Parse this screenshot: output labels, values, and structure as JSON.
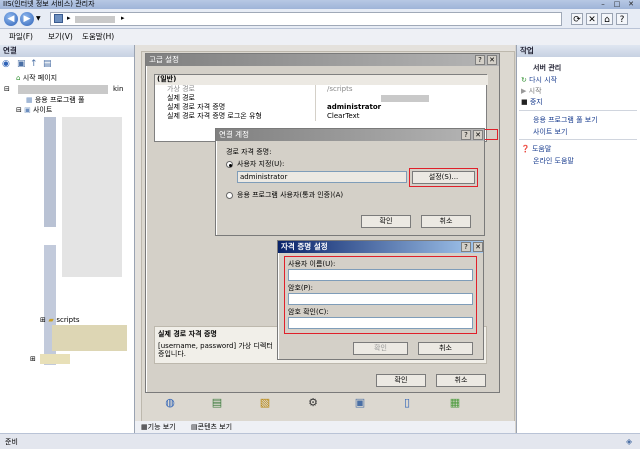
{
  "window": {
    "title": "IIS(인터넷 정보 서비스) 관리자"
  },
  "address": {
    "sep1": "▸",
    "sep2": "▸"
  },
  "menubar": {
    "items": [
      "파일(F)",
      "보기(V)",
      "도움말(H)"
    ]
  },
  "connections": {
    "header": "연결",
    "start_page": "시작 페이지",
    "server_suffix": "kin",
    "app_pools": "응용 프로그램 풀",
    "sites": "사이트",
    "scripts": "scripts"
  },
  "advanced_settings": {
    "title": "고급 설정",
    "section": "(일반)",
    "rows": [
      {
        "name": "가상 경로",
        "value": "/scripts"
      },
      {
        "name": "실제 경로",
        "value": ""
      },
      {
        "name": "실제 경로 자격 증명",
        "value": "administrator"
      },
      {
        "name": "실제 경로 자격 증명 로그온 유형",
        "value": "ClearText"
      }
    ],
    "desc_title": "실제 경로 자격 증명",
    "desc_line1": "[username, password] 가상 디렉터",
    "desc_line2": "증입니다.",
    "ok": "확인",
    "cancel": "취소"
  },
  "connect_as": {
    "title": "연결 계정",
    "path_credentials": "경로 자격 증명:",
    "specific_user": "사용자 지정(U):",
    "user_value": "administrator",
    "set_button": "설정(S)...",
    "app_user": "응용 프로그램 사용자(통과 인증)(A)",
    "ok": "확인",
    "cancel": "취소"
  },
  "set_credentials": {
    "title": "자격 증명 설정",
    "username_label": "사용자 이름(U):",
    "password_label": "암호(P):",
    "confirm_label": "암호 확인(C):",
    "ok": "확인",
    "cancel": "취소"
  },
  "actions": {
    "header": "작업",
    "group": "서버 관리",
    "items": [
      "다시 시작",
      "시작",
      "중지"
    ],
    "links": [
      "응용 프로그램 풀 보기",
      "사이트 보기"
    ],
    "help": [
      "도움말",
      "온라인 도움말"
    ]
  },
  "view_tabs": {
    "features": "기능 보기",
    "content": "콘텐츠 보기"
  },
  "status": {
    "text": "준비"
  },
  "colors": {
    "highlight_box": "#e0202a",
    "title_active": "#0a246a"
  }
}
